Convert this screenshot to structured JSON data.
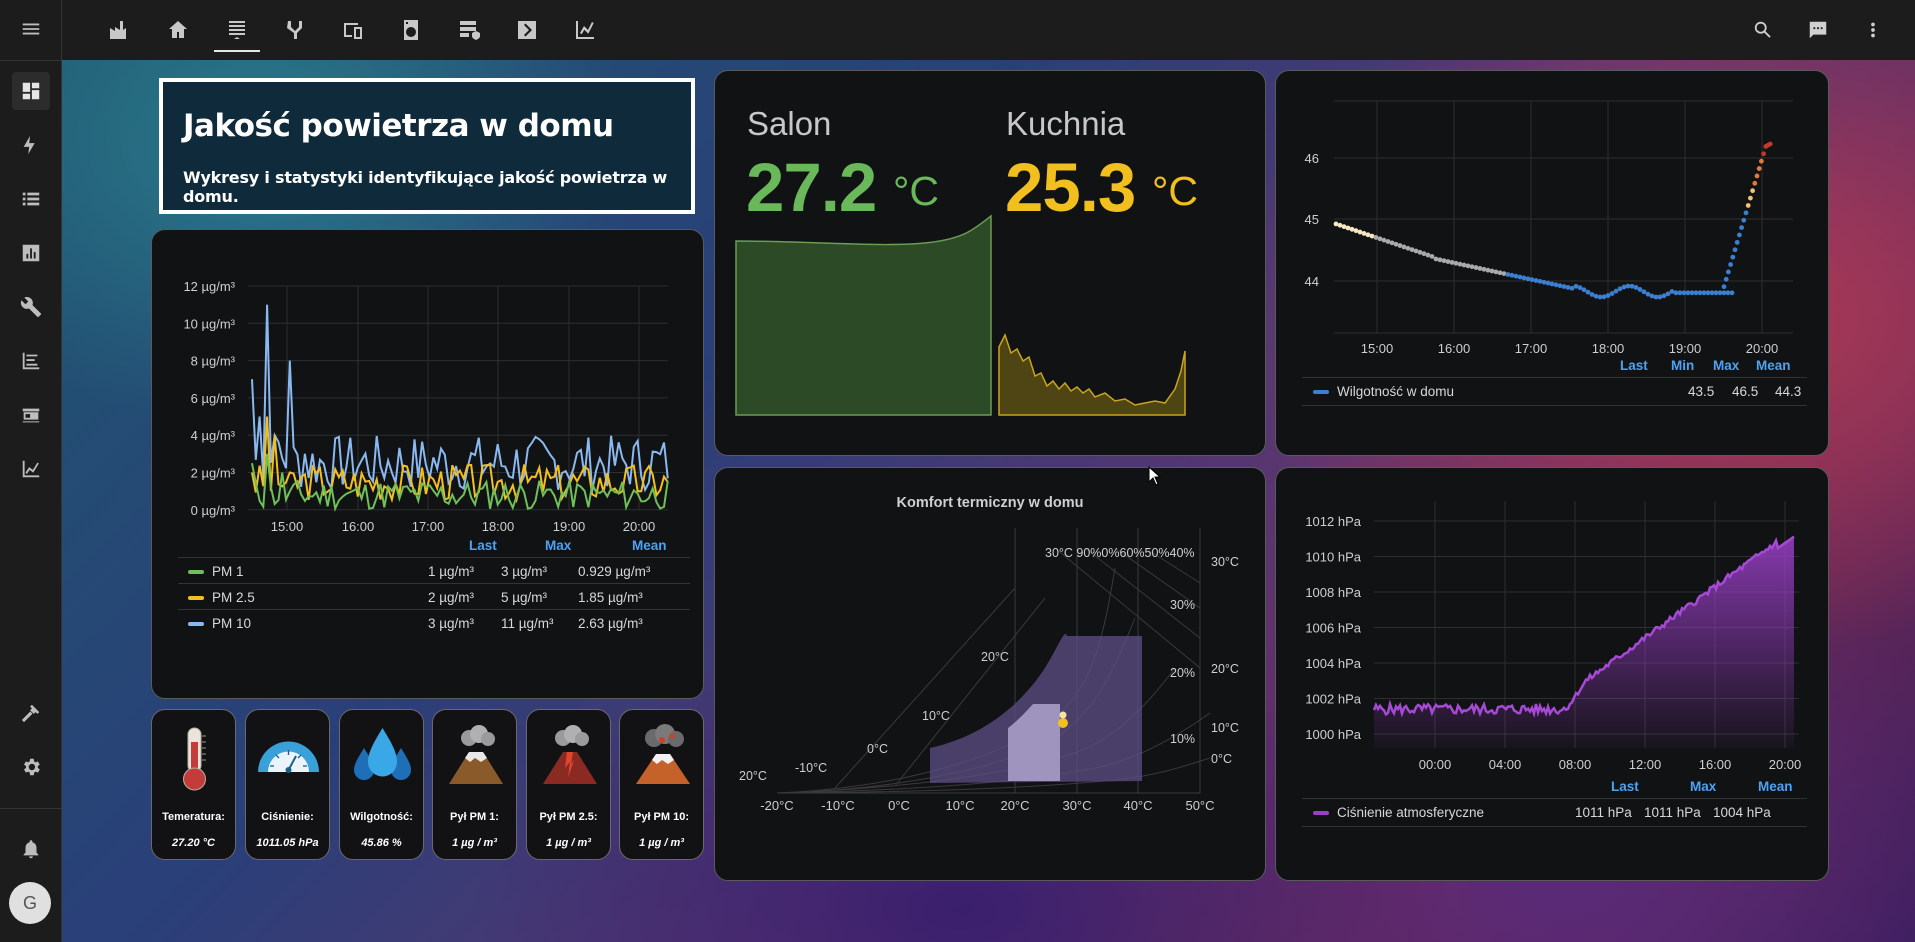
{
  "topbar": {
    "tabs": [
      {
        "icon": "factory-icon"
      },
      {
        "icon": "home-icon"
      },
      {
        "icon": "air-filter-icon"
      },
      {
        "icon": "pipe-icon"
      },
      {
        "icon": "devices-icon"
      },
      {
        "icon": "washing-machine-icon"
      },
      {
        "icon": "server-shield-icon"
      },
      {
        "icon": "chevron-box-icon"
      },
      {
        "icon": "chart-icon"
      }
    ],
    "active_tab": 2,
    "right": [
      "search-icon",
      "chat-icon",
      "dots-vertical-icon"
    ]
  },
  "sidebar": {
    "items": [
      "dashboard-icon",
      "lightning-icon",
      "list-icon",
      "chart-bar-icon",
      "wrench-icon",
      "logbook-icon",
      "hacs-icon",
      "history-icon"
    ],
    "bottom": [
      "hammer-icon",
      "cog-icon",
      "bell-icon"
    ],
    "avatar": "G"
  },
  "title_card": {
    "title": "Jakość powietrza w domu",
    "subtitle": "Wykresy i statystyki identyfikujące jakość powietrza w domu."
  },
  "pm_card": {
    "yticks": [
      "12 µg/m³",
      "10 µg/m³",
      "8 µg/m³",
      "6 µg/m³",
      "4 µg/m³",
      "2 µg/m³",
      "0 µg/m³"
    ],
    "xticks": [
      "15:00",
      "16:00",
      "17:00",
      "18:00",
      "19:00",
      "20:00"
    ],
    "headers": [
      "Last",
      "Max",
      "Mean"
    ],
    "rows": [
      {
        "name": "PM 1",
        "color": "#6fbf5a",
        "last": "1 µg/m³",
        "max": "3 µg/m³",
        "mean": "0.929 µg/m³"
      },
      {
        "name": "PM 2.5",
        "color": "#f2c01e",
        "last": "2 µg/m³",
        "max": "5 µg/m³",
        "mean": "1.85 µg/m³"
      },
      {
        "name": "PM 10",
        "color": "#8ab8f0",
        "last": "3 µg/m³",
        "max": "11 µg/m³",
        "mean": "2.63 µg/m³"
      }
    ]
  },
  "temp_card": {
    "salon": {
      "name": "Salon",
      "value": "27.2",
      "unit": "°C",
      "color": "#69b85a"
    },
    "kuchnia": {
      "name": "Kuchnia",
      "value": "25.3",
      "unit": "°C",
      "color": "#f2c01e"
    }
  },
  "humidity_card": {
    "yticks": [
      "46",
      "45",
      "44"
    ],
    "xticks": [
      "15:00",
      "16:00",
      "17:00",
      "18:00",
      "19:00",
      "20:00"
    ],
    "headers": [
      "Last",
      "Min",
      "Max",
      "Mean"
    ],
    "row": {
      "name": "Wilgotność w domu",
      "color": "#3b7fd0",
      "min": "43.5",
      "max": "46.5",
      "mean": "44.3"
    }
  },
  "comfort_card": {
    "title": "Komfort termiczny w domu",
    "xticks": [
      "-20°C",
      "-10°C",
      "0°C",
      "10°C",
      "20°C",
      "30°C",
      "40°C",
      "50°C"
    ],
    "right_ticks": [
      "30°C",
      "20°C",
      "10°C",
      "0°C"
    ],
    "rh_labels": [
      "30%",
      "20%",
      "10%"
    ],
    "top_labels": "30°C 90%0%60%50%40%",
    "curve_labels": [
      "20°C",
      "10°C",
      "0°C",
      "-10°C",
      "20°C"
    ]
  },
  "pressure_card": {
    "yticks": [
      "1012 hPa",
      "1010 hPa",
      "1008 hPa",
      "1006 hPa",
      "1004 hPa",
      "1002 hPa",
      "1000 hPa"
    ],
    "xticks": [
      "00:00",
      "04:00",
      "08:00",
      "12:00",
      "16:00",
      "20:00"
    ],
    "headers": [
      "Last",
      "Max",
      "Mean"
    ],
    "row": {
      "name": "Ciśnienie atmosferyczne",
      "color": "#9b3fc9",
      "last": "1011 hPa",
      "max": "1011 hPa",
      "mean": "1004 hPa"
    }
  },
  "sensors": [
    {
      "icon": "thermometer-icon",
      "label": "Temeratura:",
      "value": "27.20 °C"
    },
    {
      "icon": "pressure-gauge-icon",
      "label": "Ciśnienie:",
      "value": "1011.05 hPa"
    },
    {
      "icon": "water-drops-icon",
      "label": "Wilgotność:",
      "value": "45.86 %"
    },
    {
      "icon": "volcano-icon",
      "label": "Pył PM 1:",
      "value": "1 µg / m³"
    },
    {
      "icon": "volcano-erupting-icon",
      "label": "Pył PM 2.5:",
      "value": "1 µg / m³"
    },
    {
      "icon": "volcano-smoke-icon",
      "label": "Pył PM 10:",
      "value": "1 µg / m³"
    }
  ]
}
